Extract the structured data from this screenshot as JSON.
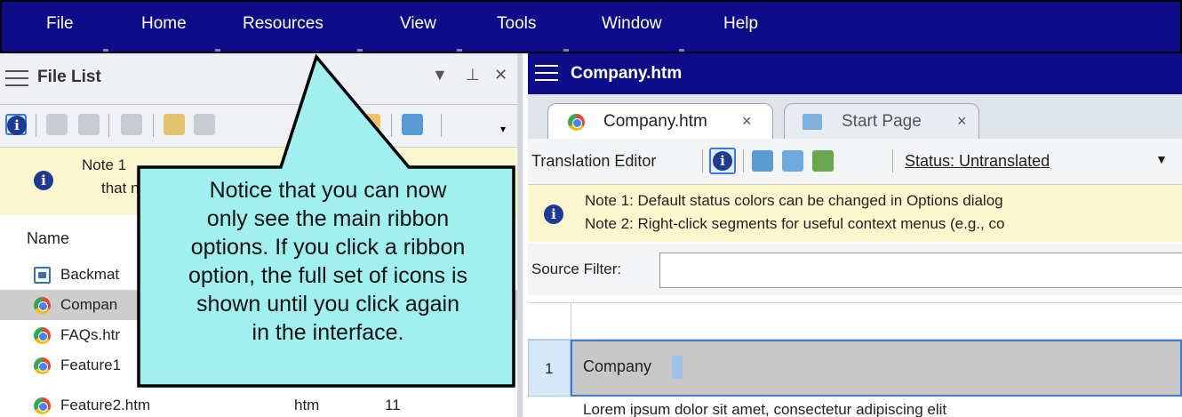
{
  "menu": {
    "items": [
      "File",
      "Home",
      "Resources",
      "View",
      "Tools",
      "Window",
      "Help"
    ]
  },
  "file_list": {
    "title": "File List",
    "pin_icon": "pin-icon",
    "note": [
      "Note 1",
      "that n"
    ],
    "columns": [
      "Name"
    ],
    "files": [
      {
        "name": "Backmat",
        "type": "",
        "size": "",
        "icon": "document-icon"
      },
      {
        "name": "Compan",
        "type": "",
        "size": "",
        "icon": "chrome-icon",
        "selected": true
      },
      {
        "name": "FAQs.htr",
        "type": "",
        "size": "",
        "icon": "chrome-icon"
      },
      {
        "name": "Feature1",
        "type": "",
        "size": "",
        "icon": "chrome-icon"
      },
      {
        "name": "Feature2.htm",
        "type": "htm",
        "size": "11",
        "icon": "chrome-icon"
      }
    ]
  },
  "editor": {
    "title": "Company.htm",
    "tabs": [
      {
        "label": "Company.htm",
        "close": "×",
        "active": true
      },
      {
        "label": "Start Page",
        "close": "×",
        "active": false
      }
    ],
    "translation_editor_label": "Translation Editor",
    "status": "Status: Untranslated",
    "notes": [
      "Note 1: Default status colors can be changed in Options dialog",
      "Note 2: Right-click segments for useful context menus (e.g., co"
    ],
    "source_filter_label": "Source Filter:",
    "segments": [
      {
        "number": "1",
        "text": "Company"
      }
    ],
    "next_segment_preview": "Lorem ipsum dolor sit amet, consectetur adipiscing elit"
  },
  "callout": {
    "lines": [
      "Notice that you can now",
      "only see the main ribbon",
      "options. If you click a ribbon",
      "option, the full set of icons is",
      "shown until you click again",
      "in the interface."
    ]
  },
  "colors": {
    "menubar": "#0d0d8a",
    "note_bg": "#fdf7cf",
    "callout_fill": "#9ff0ef",
    "selected_row": "#cdcdcd"
  }
}
